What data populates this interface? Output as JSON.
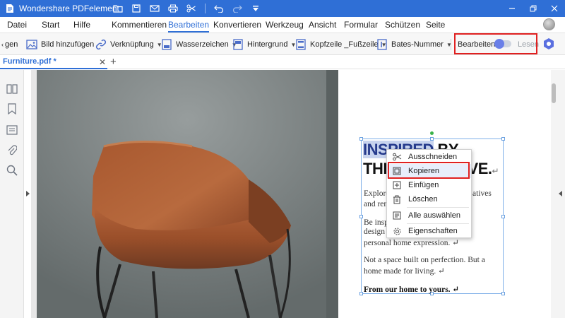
{
  "app": {
    "title": "Wondershare PDFelement",
    "brand_color": "#2f6fd6"
  },
  "titlebar": {
    "icons": [
      "folder-icon",
      "save-icon",
      "mail-icon",
      "print-icon",
      "scissors-icon",
      "undo-icon",
      "redo-icon",
      "dropdown-icon"
    ],
    "window_controls": [
      "minimize-icon",
      "restore-icon",
      "close-icon"
    ]
  },
  "menu": {
    "items": [
      {
        "label": "Datei",
        "active": false
      },
      {
        "label": "Start",
        "active": false
      },
      {
        "label": "Hilfe",
        "active": false
      },
      {
        "label": "Kommentieren",
        "active": false
      },
      {
        "label": "Bearbeiten",
        "active": true
      },
      {
        "label": "Konvertieren",
        "active": false
      },
      {
        "label": "Werkzeug",
        "active": false
      },
      {
        "label": "Ansicht",
        "active": false
      },
      {
        "label": "Formular",
        "active": false
      },
      {
        "label": "Schützen",
        "active": false
      },
      {
        "label": "Seite",
        "active": false
      }
    ]
  },
  "toolbar": {
    "truncated_label": "gen",
    "tools": [
      {
        "label": "Bild hinzufügen",
        "icon": "image-icon",
        "dropdown": false
      },
      {
        "label": "Verknüpfung",
        "icon": "link-icon",
        "dropdown": true
      },
      {
        "label": "Wasserzeichen",
        "icon": "watermark-icon",
        "dropdown": true
      },
      {
        "label": "Hintergrund",
        "icon": "background-icon",
        "dropdown": true
      },
      {
        "label": "Kopfzeile _Fußzeile",
        "icon": "header-footer-icon",
        "dropdown": true
      },
      {
        "label": "Bates-Nummer",
        "icon": "bates-number-icon",
        "dropdown": true
      }
    ],
    "mode": {
      "edit_label": "Bearbeiten",
      "read_label": "Lesen",
      "highlight_color": "#e02020"
    }
  },
  "tabs": [
    {
      "label": "Furniture.pdf *",
      "active": true
    }
  ],
  "sidebar": {
    "icons": [
      "thumbnails-icon",
      "bookmark-icon",
      "comment-icon",
      "attachment-icon",
      "search-icon"
    ]
  },
  "document": {
    "heading": {
      "line1_selected": "INSPIRED",
      "line1_rest": " BY",
      "line2_start": "THI",
      "line2_end": "TIVE.",
      "line_end_mark": "↵"
    },
    "paragraphs": [
      {
        "left": "Explore",
        "right": "atives"
      },
      {
        "left": "and reno",
        "right": ""
      },
      {
        "left": "Be inspi",
        "right": ""
      },
      {
        "left": "design a",
        "right": ""
      },
      {
        "left": "personal home expression. ↵",
        "right": ""
      },
      {
        "left": "Not a space built on perfection. But a",
        "right": ""
      },
      {
        "left": "home made for living. ↵",
        "right": ""
      },
      {
        "left": "From our home to yours. ↵",
        "right": "",
        "bold": true
      }
    ]
  },
  "context_menu": {
    "items": [
      {
        "label": "Ausschneiden",
        "icon": "scissors-icon"
      },
      {
        "label": "Kopieren",
        "icon": "copy-icon",
        "highlighted": true
      },
      {
        "label": "Einfügen",
        "icon": "paste-icon"
      },
      {
        "label": "Löschen",
        "icon": "delete-icon"
      },
      {
        "label": "Alle auswählen",
        "icon": "select-all-icon"
      },
      {
        "label": "Eigenschaften",
        "icon": "gear-icon"
      }
    ]
  }
}
